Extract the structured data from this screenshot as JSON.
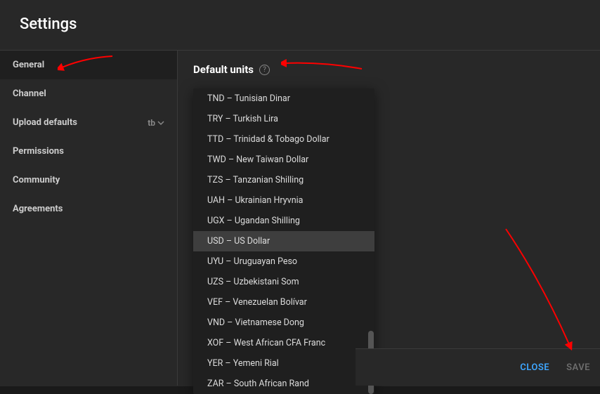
{
  "title": "Settings",
  "sidebar": {
    "items": [
      {
        "label": "General",
        "active": true
      },
      {
        "label": "Channel"
      },
      {
        "label": "Upload defaults",
        "badge": "tb"
      },
      {
        "label": "Permissions"
      },
      {
        "label": "Community"
      },
      {
        "label": "Agreements"
      }
    ]
  },
  "main": {
    "section_title": "Default units",
    "dropdown": {
      "items": [
        {
          "label": "TND – Tunisian Dinar"
        },
        {
          "label": "TRY – Turkish Lira"
        },
        {
          "label": "TTD – Trinidad & Tobago Dollar"
        },
        {
          "label": "TWD – New Taiwan Dollar"
        },
        {
          "label": "TZS – Tanzanian Shilling"
        },
        {
          "label": "UAH – Ukrainian Hryvnia"
        },
        {
          "label": "UGX – Ugandan Shilling"
        },
        {
          "label": "USD – US Dollar",
          "selected": true
        },
        {
          "label": "UYU – Uruguayan Peso"
        },
        {
          "label": "UZS – Uzbekistani Som"
        },
        {
          "label": "VEF – Venezuelan Bolívar"
        },
        {
          "label": "VND – Vietnamese Dong"
        },
        {
          "label": "XOF – West African CFA Franc"
        },
        {
          "label": "YER – Yemeni Rial"
        },
        {
          "label": "ZAR – South African Rand"
        }
      ]
    }
  },
  "footer": {
    "close_label": "CLOSE",
    "save_label": "SAVE"
  },
  "annotations": {
    "arrow_color": "#ff0000"
  }
}
